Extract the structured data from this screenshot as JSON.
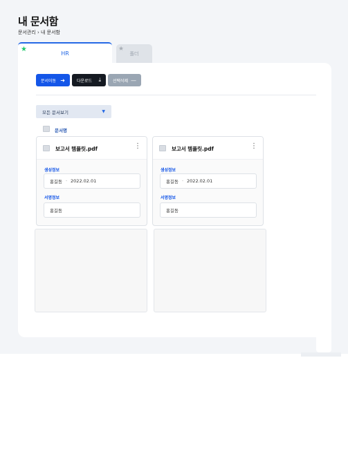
{
  "page": {
    "title": "내 문서함",
    "breadcrumb": "문서관리 › 내 문서함"
  },
  "tabs": [
    {
      "label": "HR",
      "active": true,
      "starred": true
    },
    {
      "label": "폴더",
      "active": false,
      "starred": false
    }
  ],
  "toolbar": {
    "move_label": "문서이동",
    "download_label": "다운로드",
    "delete_label": "선택삭제"
  },
  "filter": {
    "selected": "모든 문서보기"
  },
  "list": {
    "column_header": "문서명"
  },
  "documents": [
    {
      "file_name": "보고서 템플릿.pdf",
      "created_label": "생성정보",
      "created_by": "홍길동",
      "created_date": "2022.02.01",
      "signed_label": "서명정보",
      "signed_by": "홍길동"
    },
    {
      "file_name": "보고서 템플릿.pdf",
      "created_label": "생성정보",
      "created_by": "홍길동",
      "created_date": "2022.02.01",
      "signed_label": "서명정보",
      "signed_by": "홍길동"
    }
  ],
  "icons": {
    "star_active": "star-filled-icon",
    "star_inactive": "star-outline-icon",
    "move": "arrow-right-icon",
    "download": "download-icon",
    "delete": "minus-icon",
    "filter_caret": "caret-down-icon",
    "more": "kebab-menu-icon"
  },
  "colors": {
    "accent": "#2468e5",
    "primary_button": "#1456e8",
    "dark_button": "#151a22",
    "disabled_button": "#9aa6b3",
    "star_active": "#1ec96c",
    "page_bg": "#f3f5f8"
  }
}
